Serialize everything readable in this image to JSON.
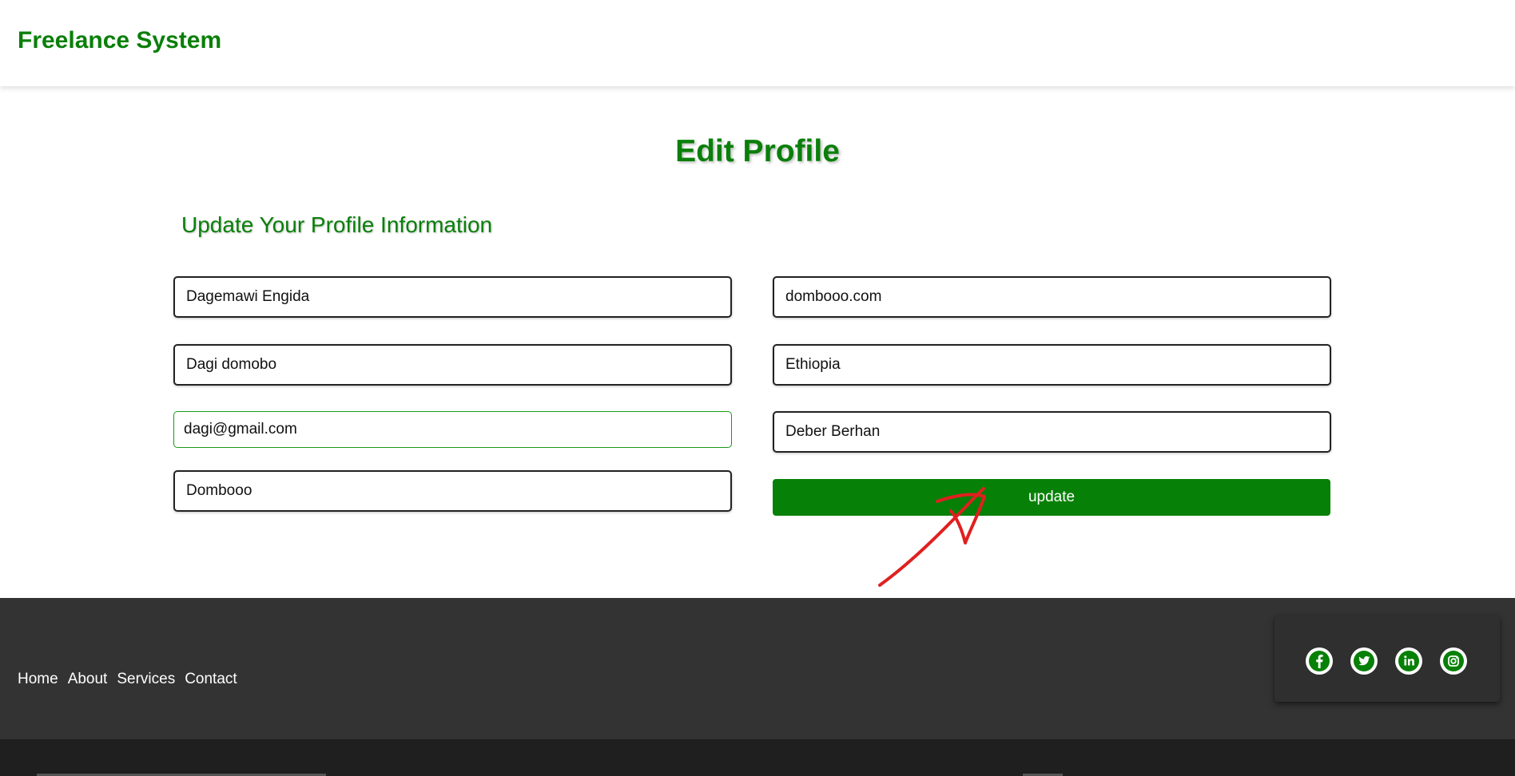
{
  "header": {
    "brand": "Freelance System"
  },
  "main": {
    "title": "Edit Profile",
    "subtitle": "Update Your Profile Information",
    "fields_left": [
      {
        "value": "Dagemawi Engida"
      },
      {
        "value": "Dagi domobo"
      },
      {
        "value": "dagi@gmail.com"
      },
      {
        "value": "Dombooo"
      }
    ],
    "fields_right": [
      {
        "value": "dombooo.com"
      },
      {
        "value": "Ethiopia"
      },
      {
        "value": "Deber Berhan"
      }
    ],
    "update_label": "update"
  },
  "footer": {
    "nav": [
      "Home",
      "About",
      "Services",
      "Contact"
    ],
    "social_icons": [
      "facebook-icon",
      "twitter-icon",
      "linkedin-icon",
      "instagram-icon"
    ]
  },
  "colors": {
    "accent": "#078007",
    "footer_bg": "#333333",
    "annotation": "#e02020"
  }
}
